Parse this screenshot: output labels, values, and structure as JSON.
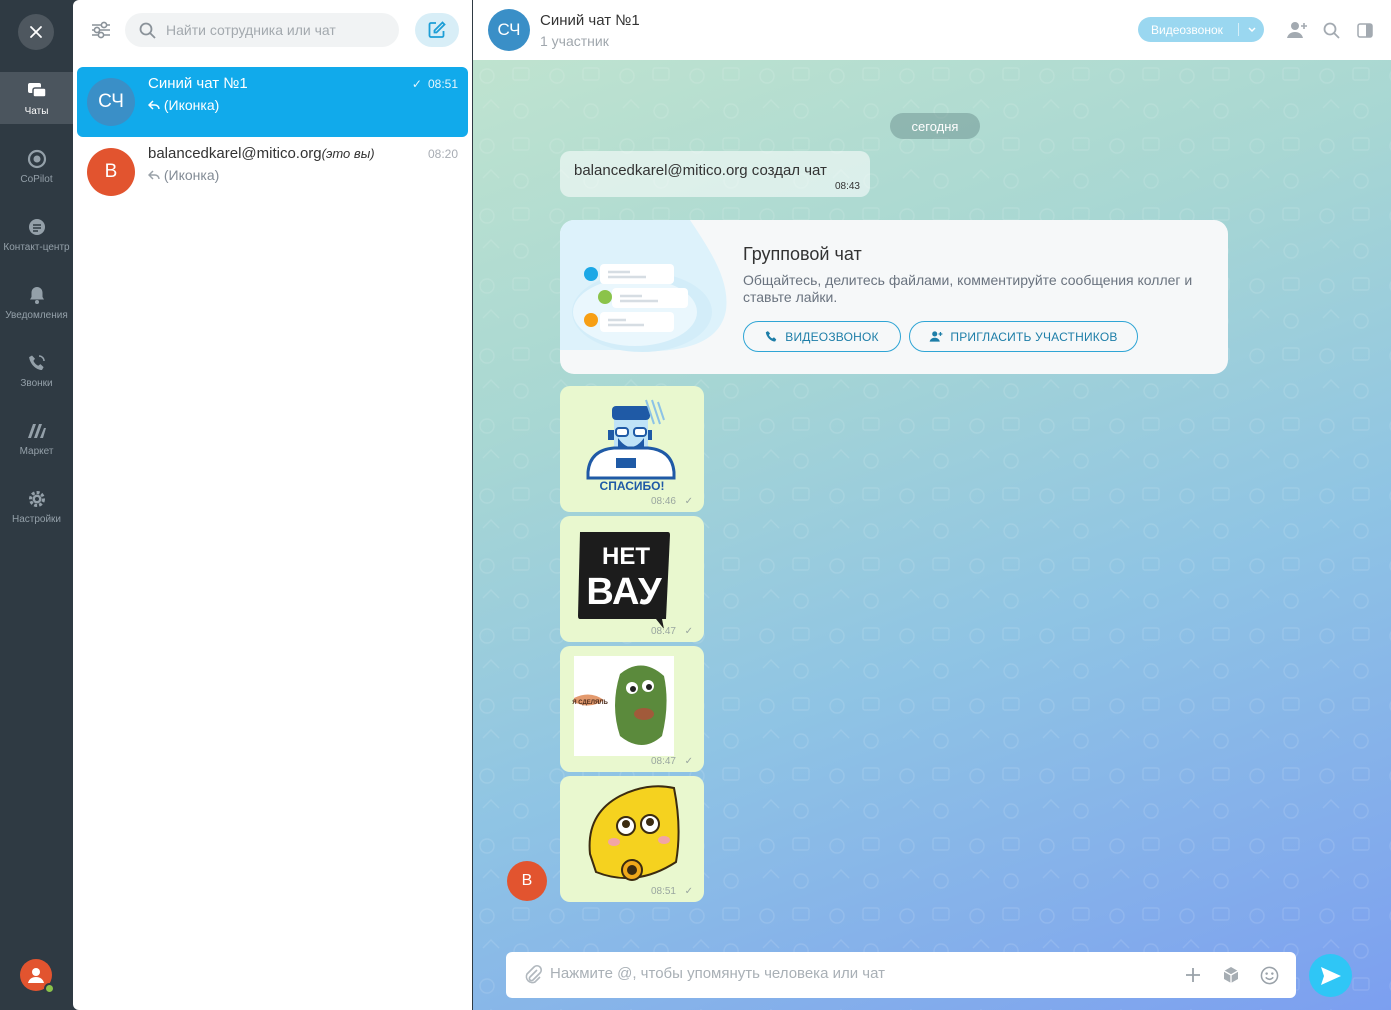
{
  "rail": {
    "close_icon": "close-icon",
    "items": [
      {
        "label": "Чаты",
        "icon": "chats-icon",
        "active": true
      },
      {
        "label": "CoPilot",
        "icon": "copilot-icon",
        "active": false
      },
      {
        "label": "Контакт-центр",
        "icon": "contact-center-icon",
        "active": false
      },
      {
        "label": "Уведомления",
        "icon": "bell-icon",
        "active": false
      },
      {
        "label": "Звонки",
        "icon": "phone-icon",
        "active": false
      },
      {
        "label": "Маркет",
        "icon": "market-icon",
        "active": false
      },
      {
        "label": "Настройки",
        "icon": "gear-icon",
        "active": false
      }
    ]
  },
  "list": {
    "search_placeholder": "Найти сотрудника или чат",
    "chats": [
      {
        "avatar": "СЧ",
        "avatar_color": "#3a8fc7",
        "title": "Синий чат №1",
        "title_note": "",
        "preview": "(Иконка)",
        "time": "08:51",
        "read": true,
        "active": true
      },
      {
        "avatar": "B",
        "avatar_color": "#e2542f",
        "title": "balancedkarel@mitico.org",
        "title_note": "(это вы)",
        "preview": "(Иконка)",
        "time": "08:20",
        "read": false,
        "active": false
      }
    ]
  },
  "header": {
    "avatar": "СЧ",
    "title": "Синий чат №1",
    "subtitle": "1 участник",
    "video_call": "Видеозвонок"
  },
  "messages": {
    "date": "сегодня",
    "system_text": "balancedkarel@mitico.org создал чат",
    "system_time": "08:43",
    "card": {
      "title": "Групповой чат",
      "description": "Общайтесь, делитесь файлами, комментируйте сообщения коллег и ставьте лайки.",
      "video_button": "ВИДЕОЗВОНОК",
      "invite_button": "ПРИГЛАСИТЬ УЧАСТНИКОВ"
    },
    "stickers": [
      {
        "name": "sticker-spasibo",
        "time": "08:46",
        "caption": "СПАСИБО!"
      },
      {
        "name": "sticker-net-vau",
        "time": "08:47",
        "caption_top": "НЕТ",
        "caption_bottom": "ВАУ"
      },
      {
        "name": "sticker-ya-sdelyal",
        "time": "08:47",
        "caption": "Я СДЕЛЯЛЬ"
      },
      {
        "name": "sticker-yellow-cat",
        "time": "08:51"
      }
    ],
    "sender_avatar": "B",
    "check": "✓"
  },
  "composer": {
    "placeholder": "Нажмите @, чтобы упомянуть человека или чат"
  },
  "colors": {
    "accent": "#11aaeb",
    "send": "#2fc6f6",
    "rail": "#2f3a43",
    "user_avatar": "#e2542f"
  }
}
